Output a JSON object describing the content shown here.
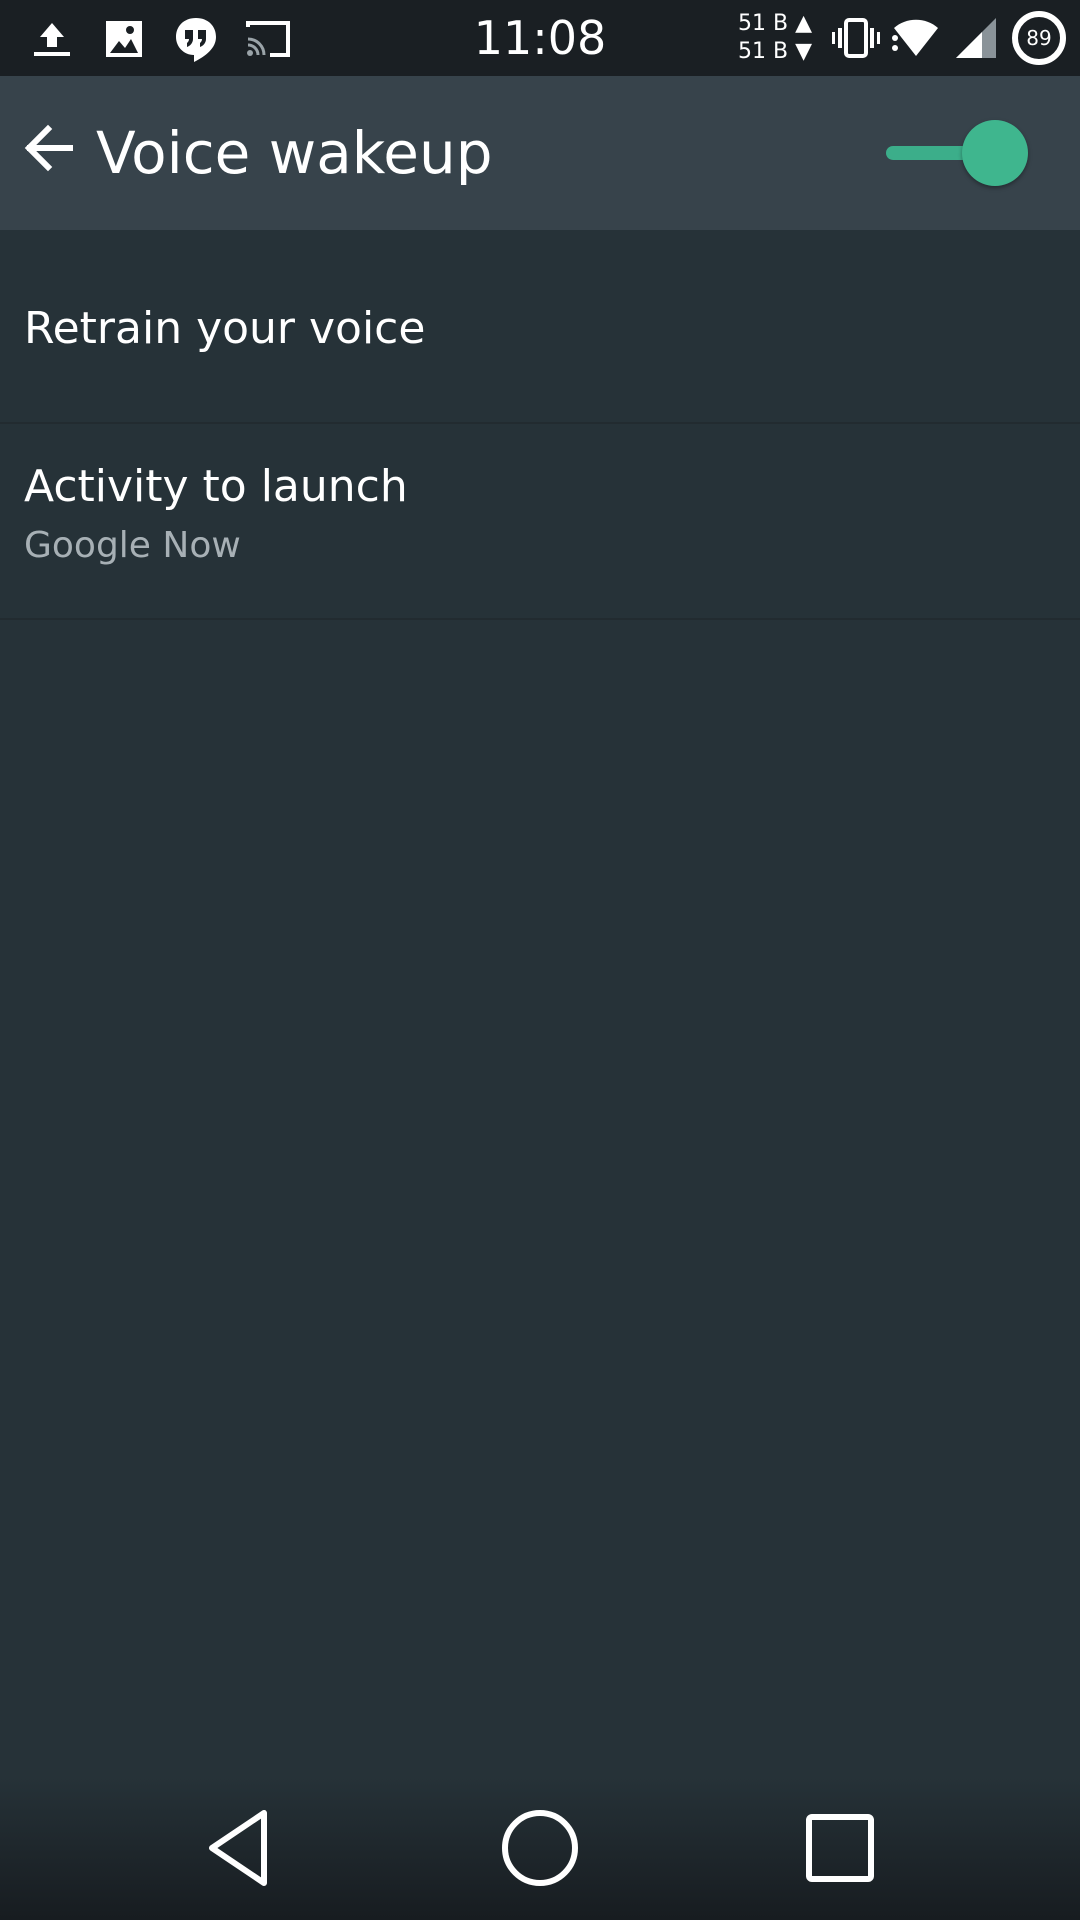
{
  "status_bar": {
    "time": "11:08",
    "net_up": "51 B ▲",
    "net_down": "51 B ▼",
    "battery_level": "89",
    "icons": [
      "upload-icon",
      "image-icon",
      "hangouts-icon",
      "cast-icon",
      "vibrate-icon",
      "wifi-icon",
      "cell-signal-icon",
      "battery-icon"
    ]
  },
  "app_bar": {
    "title": "Voice wakeup",
    "switch_on": true
  },
  "settings": {
    "items": [
      {
        "title": "Retrain your voice"
      },
      {
        "title": "Activity to launch",
        "summary": "Google Now"
      }
    ]
  },
  "colors": {
    "accent": "#3fb68e",
    "background": "#263238",
    "app_bar": "#37434b",
    "status_bar": "#1a1f23"
  }
}
